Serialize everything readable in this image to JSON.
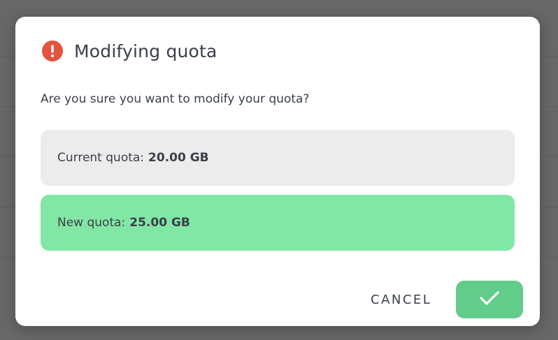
{
  "dialog": {
    "title": "Modifying quota",
    "title_icon": "exclamation-circle-icon",
    "message": "Are you sure you want to modify your quota?",
    "current_quota": {
      "label": "Current quota:",
      "value": "20.00 GB"
    },
    "new_quota": {
      "label": "New quota:",
      "value": "25.00 GB"
    },
    "cancel_label": "CANCEL",
    "confirm_icon": "checkmark-icon"
  },
  "colors": {
    "alert": "#e0553b",
    "current_quota_bg": "#ececec",
    "new_quota_bg": "#82e6a5",
    "confirm_button_bg": "#62cc8b",
    "text": "#3a3f4a",
    "overlay": "#676767"
  }
}
